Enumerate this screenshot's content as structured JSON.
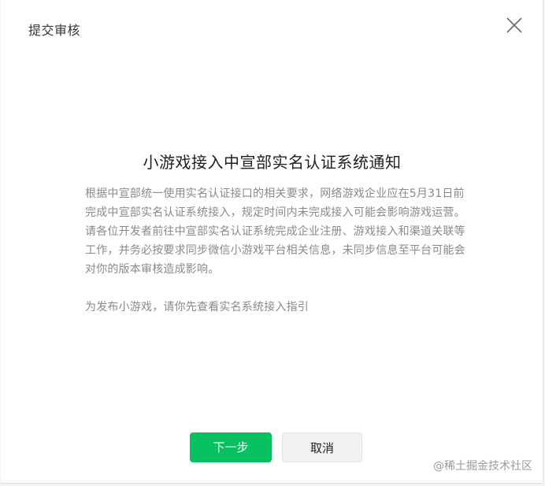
{
  "dialog": {
    "title": "提交审核"
  },
  "notice": {
    "title": "小游戏接入中宣部实名认证系统通知",
    "paragraph_1": "根据中宣部统一使用实名认证接口的相关要求，网络游戏企业应在5月31日前完成中宣部实名认证系统接入，规定时间内未完成接入可能会影响游戏运营。",
    "paragraph_2": "请各位开发者前往中宣部实名认证系统完成企业注册、游戏接入和渠道关联等工作，并务必按要求同步微信小游戏平台相关信息，未同步信息至平台可能会对你的版本审核造成影响。",
    "paragraph_3": "为发布小游戏，请你先查看实名系统接入指引"
  },
  "buttons": {
    "next_label": "下一步",
    "cancel_label": "取消"
  },
  "watermark": "@稀土掘金技术社区",
  "colors": {
    "primary": "#07c160",
    "body_text": "#8a8a8a",
    "title_text": "#1f1f1f"
  },
  "icons": {
    "close": "close-icon"
  }
}
